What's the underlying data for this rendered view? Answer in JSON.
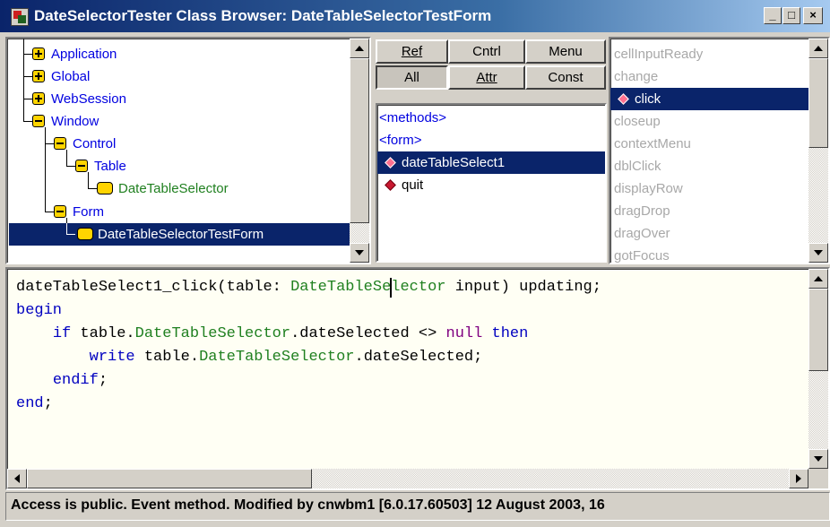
{
  "window": {
    "title": "DateSelectorTester Class Browser: DateTableSelectorTestForm",
    "minimize": "_",
    "maximize": "□",
    "close": "×"
  },
  "tree": {
    "items": [
      {
        "label": "Application",
        "state": "collapsed",
        "color": "#0000e0"
      },
      {
        "label": "Global",
        "state": "collapsed",
        "color": "#0000e0"
      },
      {
        "label": "WebSession",
        "state": "collapsed",
        "color": "#0000e0"
      },
      {
        "label": "Window",
        "state": "expanded",
        "color": "#0000e0"
      },
      {
        "label": "Control",
        "state": "expanded",
        "color": "#0000e0"
      },
      {
        "label": "Table",
        "state": "expanded",
        "color": "#0000e0"
      },
      {
        "label": "DateTableSelector",
        "state": "leaf",
        "color": "#208020"
      },
      {
        "label": "Form",
        "state": "expanded",
        "color": "#0000e0"
      },
      {
        "label": "DateTableSelectorTestForm",
        "state": "leaf-selected",
        "color": "#ffffff"
      }
    ]
  },
  "tabs": {
    "ref": "Ref",
    "cntrl": "Cntrl",
    "menu": "Menu",
    "all": "All",
    "attr": "Attr",
    "const": "Const"
  },
  "methods": {
    "items": [
      {
        "label": "<methods>",
        "kind": "header"
      },
      {
        "label": "<form>",
        "kind": "header"
      },
      {
        "label": "dateTableSelect1",
        "kind": "method",
        "selected": true
      },
      {
        "label": "quit",
        "kind": "method",
        "selected": false
      }
    ]
  },
  "events": {
    "items": [
      {
        "label": "cellInputReady",
        "selected": false
      },
      {
        "label": "change",
        "selected": false
      },
      {
        "label": "click",
        "selected": true
      },
      {
        "label": "closeup",
        "selected": false
      },
      {
        "label": "contextMenu",
        "selected": false
      },
      {
        "label": "dblClick",
        "selected": false
      },
      {
        "label": "displayRow",
        "selected": false
      },
      {
        "label": "dragDrop",
        "selected": false
      },
      {
        "label": "dragOver",
        "selected": false
      },
      {
        "label": "gotFocus",
        "selected": false
      }
    ]
  },
  "code": {
    "l1_a": "dateTableSelect1_click(table: ",
    "l1_b": "DateTableSelector",
    "l1_c": " input) updating;",
    "l2": "begin",
    "l3_indent": "    ",
    "l3_kw": "if",
    "l3_a": " table.",
    "l3_b": "DateTableSelector",
    "l3_c": ".dateSelected <> ",
    "l3_null": "null",
    "l3_then": " then",
    "l4_indent": "        ",
    "l4_kw": "write",
    "l4_a": " table.",
    "l4_b": "DateTableSelector",
    "l4_c": ".dateSelected;",
    "l5_indent": "    ",
    "l5_kw": "endif",
    "l5_c": ";",
    "l6_kw": "end",
    "l6_c": ";"
  },
  "status": {
    "text": "Access is public. Event method. Modified by cnwbm1 [6.0.17.60503] 12 August 2003, 16"
  },
  "colors": {
    "selection": "#0a246a",
    "keyword": "#0000c0",
    "class_name": "#208020",
    "null_literal": "#800080",
    "tree_node": "#0000e0"
  }
}
